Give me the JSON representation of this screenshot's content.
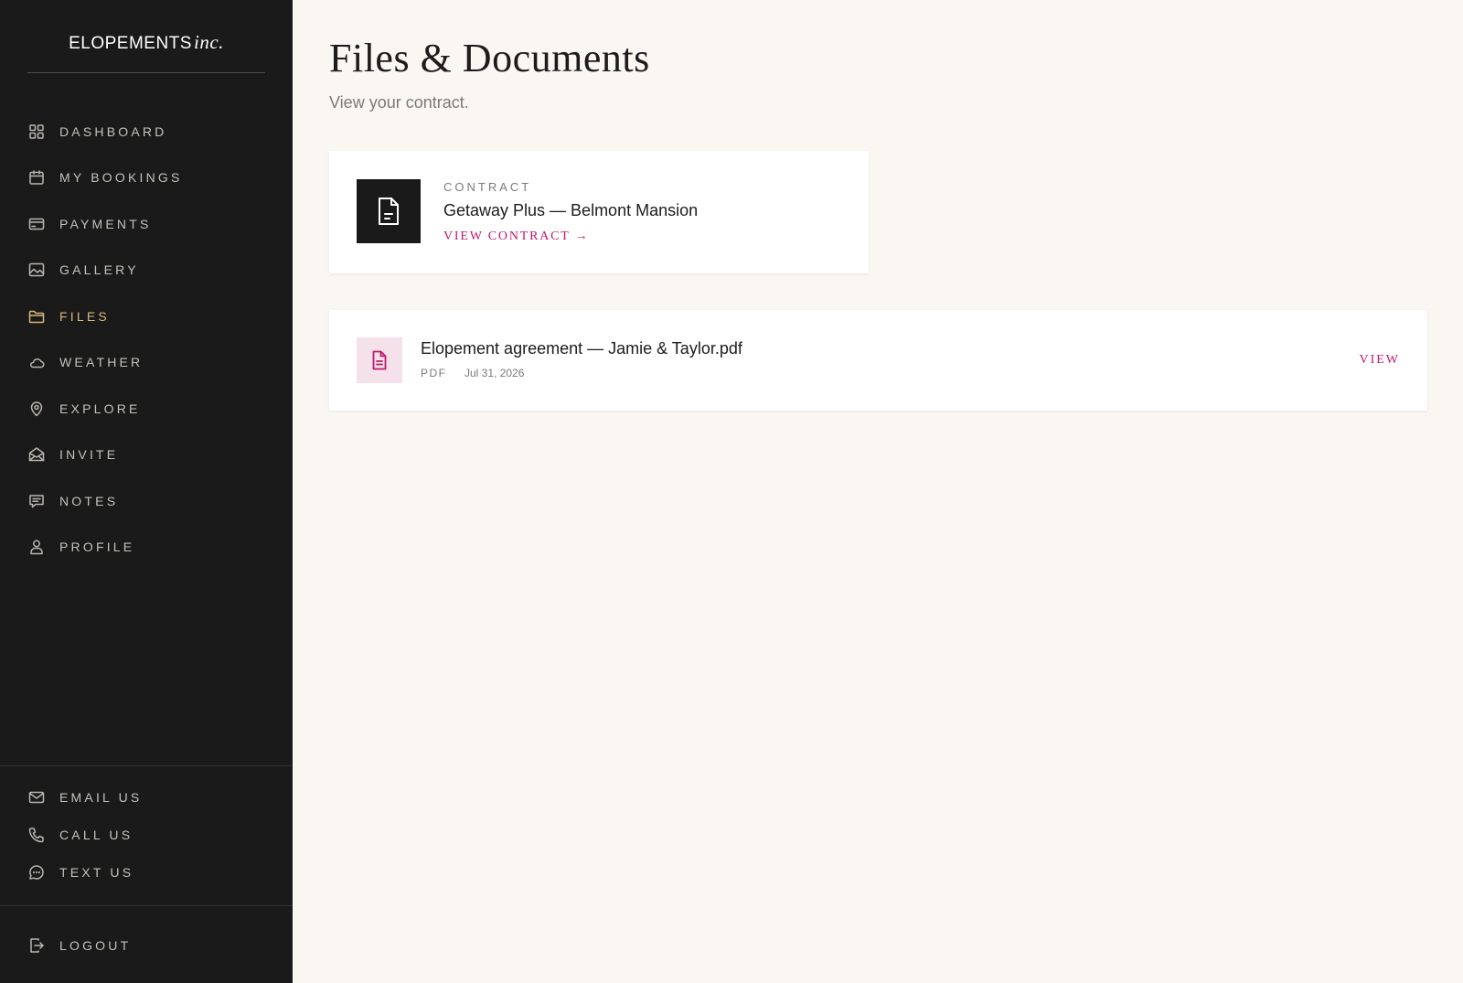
{
  "brand": {
    "name": "ELOPEMENTS",
    "suffix": "inc."
  },
  "sidebar": {
    "items": [
      {
        "label": "DASHBOARD",
        "icon": "grid-icon"
      },
      {
        "label": "MY BOOKINGS",
        "icon": "calendar-icon"
      },
      {
        "label": "PAYMENTS",
        "icon": "credit-card-icon"
      },
      {
        "label": "GALLERY",
        "icon": "image-icon"
      },
      {
        "label": "FILES",
        "icon": "folder-icon",
        "active": true
      },
      {
        "label": "WEATHER",
        "icon": "cloud-icon"
      },
      {
        "label": "EXPLORE",
        "icon": "map-pin-icon"
      },
      {
        "label": "INVITE",
        "icon": "envelope-open-icon"
      },
      {
        "label": "NOTES",
        "icon": "message-square-icon"
      },
      {
        "label": "PROFILE",
        "icon": "user-icon"
      }
    ],
    "contact": [
      {
        "label": "EMAIL US",
        "icon": "mail-icon"
      },
      {
        "label": "CALL US",
        "icon": "phone-icon"
      },
      {
        "label": "TEXT US",
        "icon": "chat-bubble-icon"
      }
    ],
    "logout": {
      "label": "LOGOUT",
      "icon": "logout-icon"
    }
  },
  "main": {
    "title": "Files & Documents",
    "subtitle": "View your contract."
  },
  "contract": {
    "kicker": "CONTRACT",
    "title": "Getaway Plus — Belmont Mansion",
    "link": "VIEW CONTRACT →",
    "icon": "document-icon"
  },
  "file": {
    "name": "Elopement agreement — Jamie & Taylor.pdf",
    "type": "PDF",
    "date": "Jul 31, 2026",
    "action": "VIEW",
    "icon": "document-icon"
  },
  "colors": {
    "sidebar_bg": "#1a1a1a",
    "page_bg": "#faf7f2",
    "accent": "#c0186e",
    "active_nav": "#d8b67a"
  }
}
